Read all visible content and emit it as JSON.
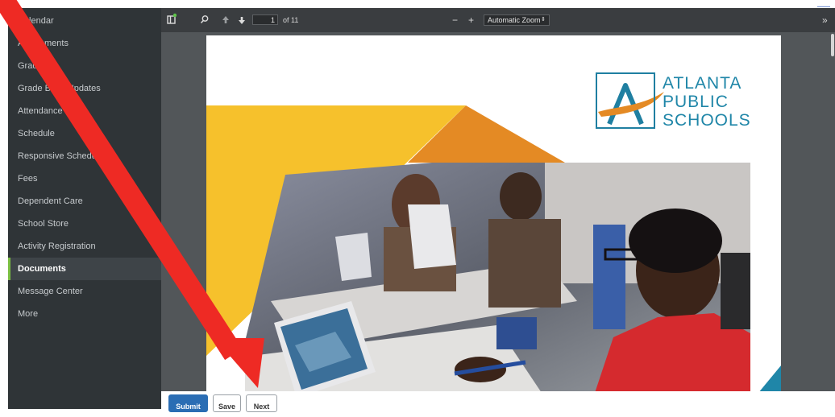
{
  "sidebar": {
    "items": [
      {
        "label": "Calendar"
      },
      {
        "label": "Assignments"
      },
      {
        "label": "Grades"
      },
      {
        "label": "Grade Book Updates"
      },
      {
        "label": "Attendance"
      },
      {
        "label": "Schedule"
      },
      {
        "label": "Responsive Schedule"
      },
      {
        "label": "Fees"
      },
      {
        "label": "Dependent Care"
      },
      {
        "label": "School Store"
      },
      {
        "label": "Activity Registration"
      },
      {
        "label": "Documents",
        "active": true
      },
      {
        "label": "Message Center"
      },
      {
        "label": "More"
      }
    ]
  },
  "viewer": {
    "page_number": "1",
    "page_count": "of 11",
    "zoom": "Automatic Zoom",
    "icons": {
      "sidebar_toggle": "sidebar-toggle-icon",
      "search": "search-icon",
      "previous": "arrow-up-icon",
      "next": "arrow-down-icon",
      "zoom_out": "minus-icon",
      "zoom_in": "plus-icon",
      "more": "double-chevron-right-icon"
    }
  },
  "document": {
    "logo_lines": [
      "ATLANTA",
      "PUBLIC",
      "SCHOOLS"
    ],
    "brand_color": "#1f86a8",
    "accent_yellow": "#f6c12c",
    "accent_orange": "#e48a24"
  },
  "buttons": {
    "submit": "Submit",
    "save": "Save",
    "next": "Next"
  },
  "annotation": {
    "arrow_color": "#ee2a24"
  }
}
